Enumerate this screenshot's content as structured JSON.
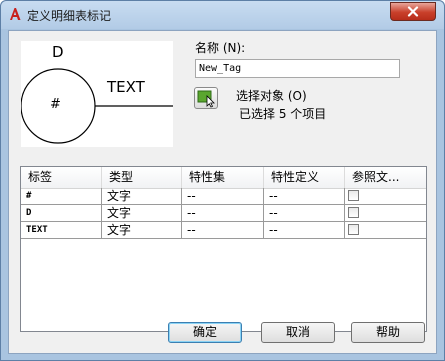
{
  "window": {
    "title": "定义明细表标记",
    "app_icon": "autocad-a-icon",
    "accent_color": "#c9402b"
  },
  "preview": {
    "top_label": "D",
    "right_label": "TEXT",
    "center_label": "#"
  },
  "name": {
    "label": "名称 (N):",
    "value": "New_Tag"
  },
  "selection": {
    "select_objects_label": "选择对象 (O)",
    "status": "已选择 5 个项目",
    "icon": "select-objects-icon"
  },
  "table": {
    "columns": [
      "标签",
      "类型",
      "特性集",
      "特性定义",
      "参照文..."
    ],
    "rows": [
      {
        "tag": "#",
        "type": "文字",
        "property_set": "--",
        "property_definition": "--",
        "reference": false
      },
      {
        "tag": "D",
        "type": "文字",
        "property_set": "--",
        "property_definition": "--",
        "reference": false
      },
      {
        "tag": "TEXT",
        "type": "文字",
        "property_set": "--",
        "property_definition": "--",
        "reference": false
      }
    ]
  },
  "buttons": {
    "ok": "确定",
    "cancel": "取消",
    "help": "帮助"
  }
}
